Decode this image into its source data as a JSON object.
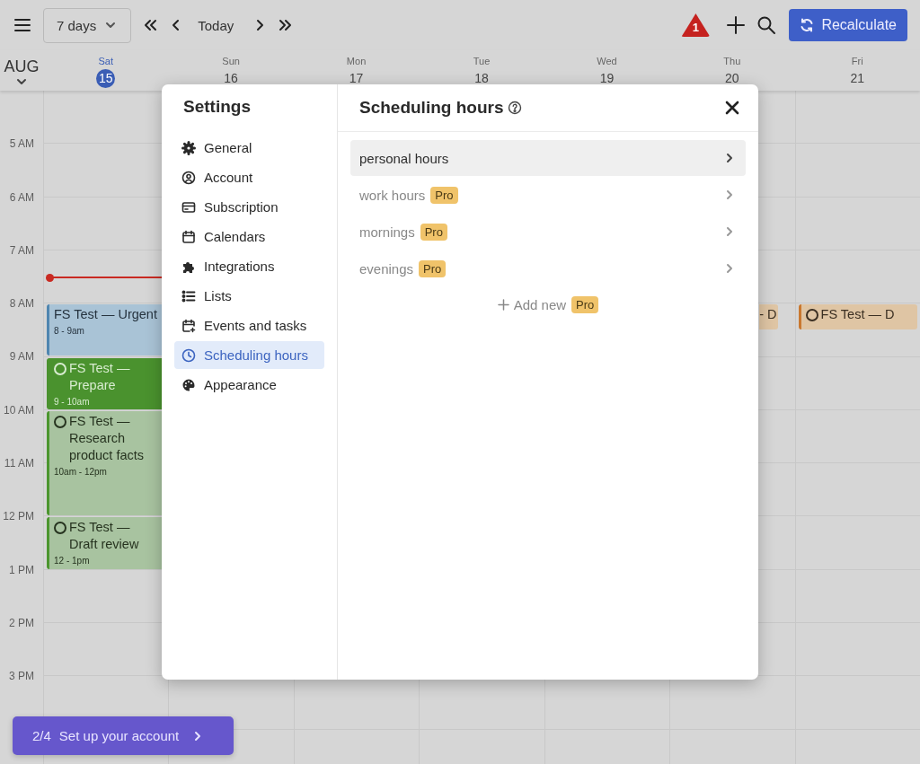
{
  "toolbar": {
    "range": "7 days",
    "today": "Today",
    "alert_count": "1",
    "action": "Recalculate"
  },
  "calendar": {
    "month": "AUG",
    "days": [
      {
        "name": "Sat",
        "number": "15",
        "selected": true
      },
      {
        "name": "Sun",
        "number": "16",
        "selected": false
      },
      {
        "name": "Mon",
        "number": "17",
        "selected": false
      },
      {
        "name": "Tue",
        "number": "18",
        "selected": false
      },
      {
        "name": "Wed",
        "number": "19",
        "selected": false
      },
      {
        "name": "Thu",
        "number": "20",
        "selected": false
      },
      {
        "name": "Fri",
        "number": "21",
        "selected": false
      }
    ],
    "hours": [
      {
        "label": "5 AM",
        "now": false
      },
      {
        "label": "6 AM",
        "now": false
      },
      {
        "label": "7 AM",
        "now": true
      },
      {
        "label": "8 AM",
        "now": false,
        "events": [
          {
            "title": "FS Test — Urgent",
            "time": "8 - 9am",
            "kind": "blue",
            "task": false,
            "color": "#4f86b0"
          },
          {
            "title": "- D",
            "kind": "partial",
            "task": false
          },
          {
            "title": "FS Test — D",
            "kind": "tan",
            "task": true,
            "color": "#c9782f"
          }
        ]
      },
      {
        "label": "9 AM",
        "now": false,
        "events": [
          {
            "title": "FS Test — Prepare",
            "time": "9 - 10am",
            "kind": "solid",
            "task": true,
            "color": "#4a922e"
          }
        ]
      },
      {
        "label": "10 AM",
        "now": false,
        "events": [
          {
            "title": "FS Test — Research product facts",
            "time": "10am - 12pm",
            "kind": "light",
            "task": true,
            "color": "#4c962e"
          }
        ]
      },
      {
        "label": "11 AM",
        "now": false
      },
      {
        "label": "12 PM",
        "now": false,
        "events": [
          {
            "title": "FS Test — Draft review",
            "time": "12 - 1pm",
            "kind": "light",
            "task": true,
            "color": "#4c962e"
          }
        ]
      },
      {
        "label": "1 PM",
        "now": false
      },
      {
        "label": "2 PM",
        "now": false
      },
      {
        "label": "3 PM",
        "now": false
      }
    ]
  },
  "settings": {
    "title": "Settings",
    "nav": [
      {
        "label": "General",
        "selected": false
      },
      {
        "label": "Account",
        "selected": false
      },
      {
        "label": "Subscription",
        "selected": false
      },
      {
        "label": "Calendars",
        "selected": false
      },
      {
        "label": "Integrations",
        "selected": false
      },
      {
        "label": "Lists",
        "selected": false
      },
      {
        "label": "Events and tasks",
        "selected": false
      },
      {
        "label": "Scheduling hours",
        "selected": true
      },
      {
        "label": "Appearance",
        "selected": false
      }
    ],
    "panel": {
      "title": "Scheduling hours",
      "rows": [
        {
          "label": "personal hours",
          "selected": true,
          "disabled": false
        },
        {
          "label": "work hours",
          "badge": "Pro",
          "selected": false,
          "disabled": true
        },
        {
          "label": "mornings",
          "badge": "Pro",
          "selected": false,
          "disabled": true
        },
        {
          "label": "evenings",
          "badge": "Pro",
          "selected": false,
          "disabled": true
        }
      ],
      "add_new": {
        "label": "Add new",
        "badge": "Pro"
      }
    }
  },
  "setup_banner": {
    "step": "2/4",
    "label": "Set up your account"
  }
}
